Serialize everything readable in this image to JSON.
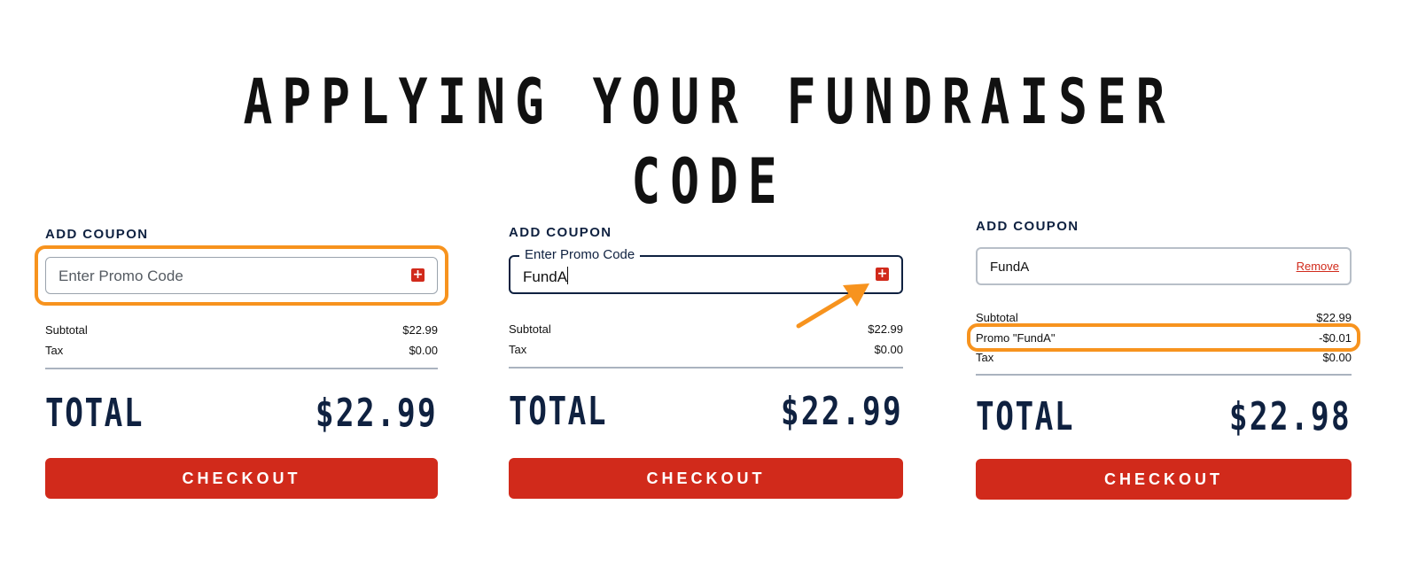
{
  "title": "APPLYING YOUR FUNDRAISER CODE",
  "accent_color": "#f7931e",
  "brand_red": "#d12a1b",
  "navy": "#0f2140",
  "steps": [
    {
      "heading": "ADD COUPON",
      "field_placeholder": "Enter Promo Code",
      "subtotal_label": "Subtotal",
      "subtotal_value": "$22.99",
      "tax_label": "Tax",
      "tax_value": "$0.00",
      "total_label": "TOTAL",
      "total_value": "$22.99",
      "checkout_label": "CHECKOUT"
    },
    {
      "heading": "ADD COUPON",
      "field_label": "Enter Promo Code",
      "field_value": "FundA",
      "subtotal_label": "Subtotal",
      "subtotal_value": "$22.99",
      "tax_label": "Tax",
      "tax_value": "$0.00",
      "total_label": "TOTAL",
      "total_value": "$22.99",
      "checkout_label": "CHECKOUT"
    },
    {
      "heading": "ADD COUPON",
      "field_value": "FundA",
      "remove_label": "Remove",
      "subtotal_label": "Subtotal",
      "subtotal_value": "$22.99",
      "promo_label": "Promo \"FundA\"",
      "promo_value": "-$0.01",
      "tax_label": "Tax",
      "tax_value": "$0.00",
      "total_label": "TOTAL",
      "total_value": "$22.98",
      "checkout_label": "CHECKOUT"
    }
  ]
}
